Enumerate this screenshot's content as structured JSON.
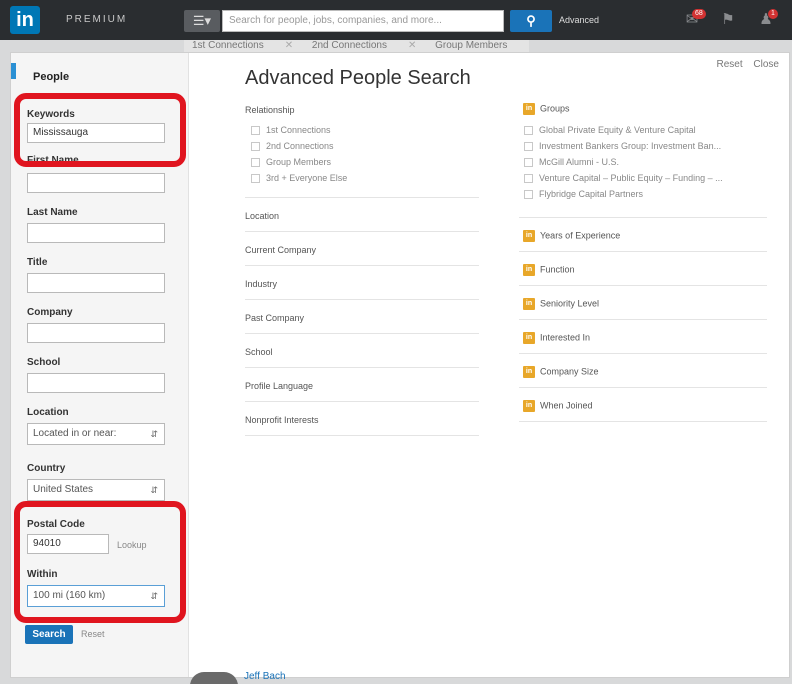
{
  "topbar": {
    "logo": "in",
    "premium": "PREMIUM",
    "search_placeholder": "Search for people, jobs, companies, and more...",
    "search_icon": "search-icon",
    "advanced": "Advanced",
    "message_badge": "68",
    "notify_badge": "1"
  },
  "chips": [
    "1st Connections",
    "2nd Connections",
    "Group Members"
  ],
  "panel": {
    "reset": "Reset",
    "close": "Close"
  },
  "left": {
    "title": "People",
    "keywords_label": "Keywords",
    "keywords_value": "Mississauga",
    "first_name_label": "First Name",
    "last_name_label": "Last Name",
    "title_label": "Title",
    "company_label": "Company",
    "school_label": "School",
    "location_label": "Location",
    "location_value": "Located in or near:",
    "country_label": "Country",
    "country_value": "United States",
    "postal_label": "Postal Code",
    "postal_value": "94010",
    "lookup": "Lookup",
    "within_label": "Within",
    "within_value": "100 mi (160 km)",
    "search_button": "Search",
    "reset": "Reset"
  },
  "main": {
    "title": "Advanced People Search",
    "relationship_label": "Relationship",
    "relationships": [
      "1st Connections",
      "2nd Connections",
      "Group Members",
      "3rd + Everyone Else"
    ],
    "sections": [
      "Location",
      "Current Company",
      "Industry",
      "Past Company",
      "School",
      "Profile Language",
      "Nonprofit Interests"
    ]
  },
  "right": {
    "groups_label": "Groups",
    "groups": [
      "Global Private Equity & Venture Capital",
      "Investment Bankers Group: Investment Ban...",
      "McGill Alumni - U.S.",
      "Venture Capital – Public Equity – Funding – ...",
      "Flybridge Capital Partners"
    ],
    "sections": [
      "Years of Experience",
      "Function",
      "Seniority Level",
      "Interested In",
      "Company Size",
      "When Joined"
    ],
    "badge": "in"
  },
  "bottom": {
    "name": "Jeff Bach"
  },
  "colors": {
    "highlight": "#e0151f",
    "brand": "#0077b5",
    "premium_badge": "#e8a729"
  }
}
